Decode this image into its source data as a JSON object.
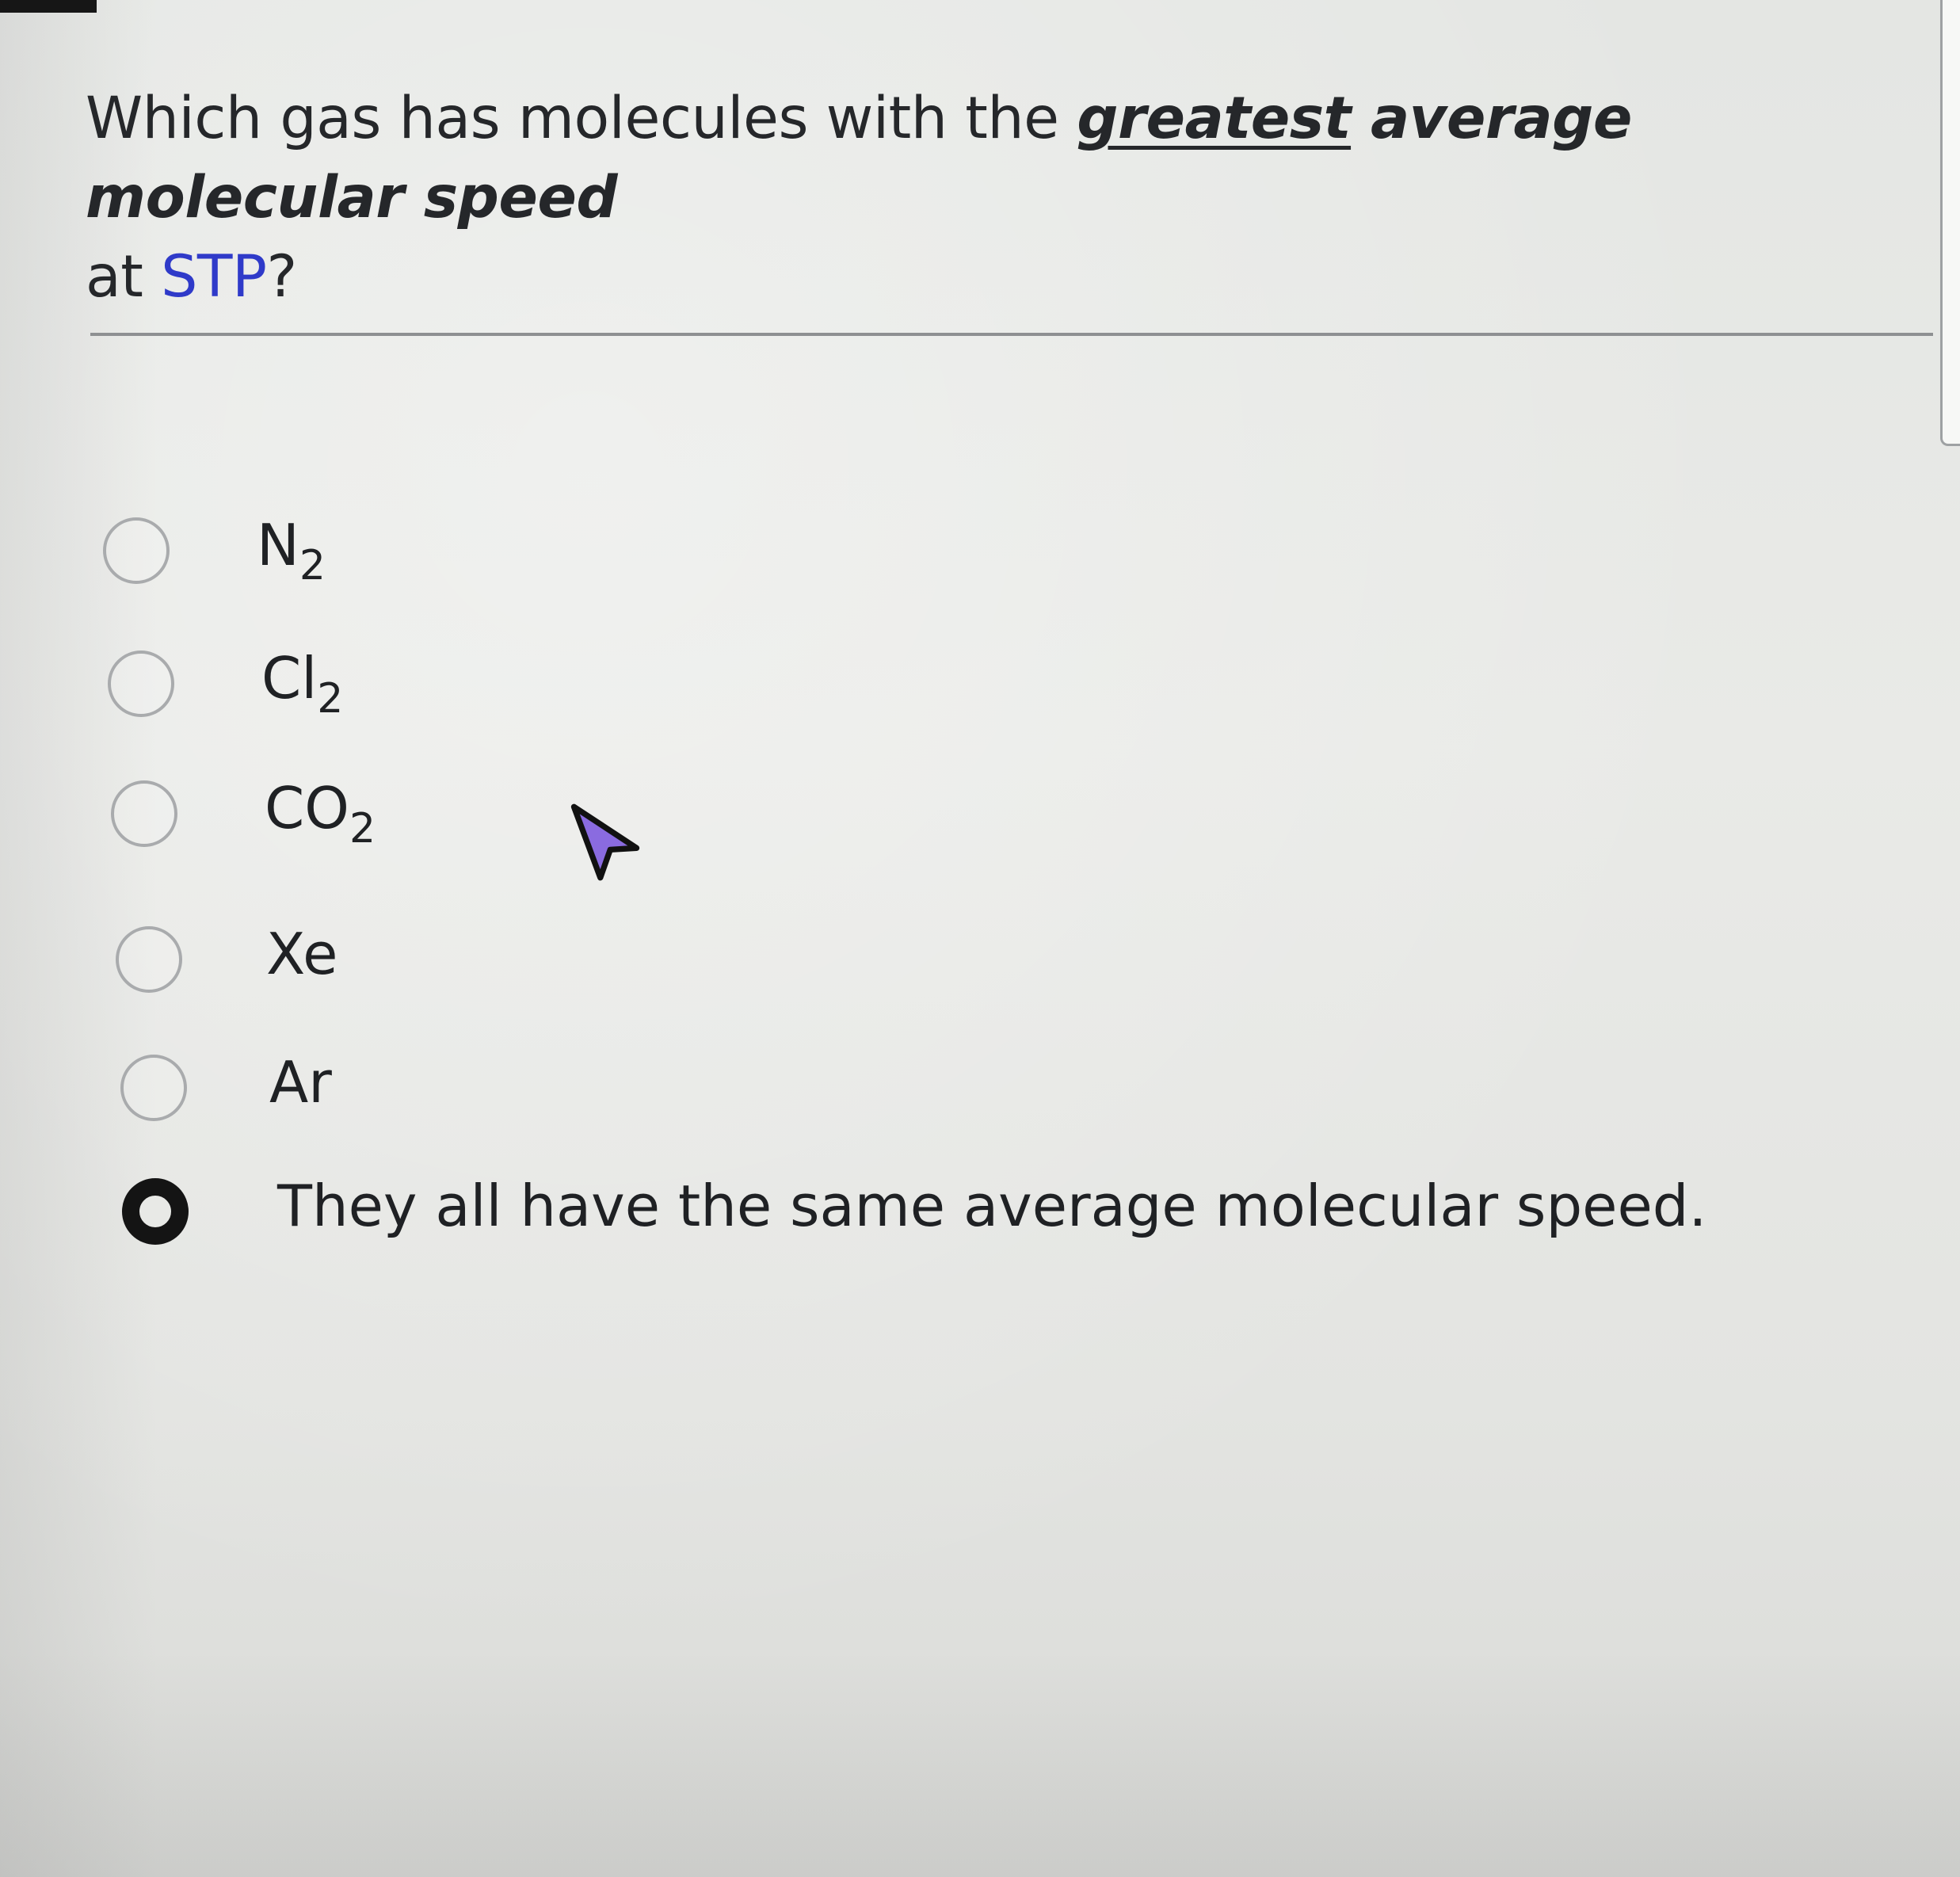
{
  "question": {
    "prefix": "Which gas has molecules with the ",
    "underlined": "greatest",
    "emphasis": " average molecular speed",
    "line2_prefix": "at ",
    "link": "STP",
    "suffix": "?"
  },
  "options": [
    {
      "label": "N",
      "sub": "2",
      "selected": false
    },
    {
      "label": "Cl",
      "sub": "2",
      "selected": false
    },
    {
      "label": "CO",
      "sub": "2",
      "selected": false
    },
    {
      "label": "Xe",
      "sub": "",
      "selected": false
    },
    {
      "label": "Ar",
      "sub": "",
      "selected": false
    },
    {
      "label": "They all have the same average molecular speed.",
      "sub": "",
      "selected": true
    }
  ],
  "colors": {
    "link": "#2f3ac9",
    "selected_radio": "#141414",
    "cursor_fill": "#8a6be0"
  },
  "icons": {
    "cursor": "mouse-pointer-icon"
  }
}
